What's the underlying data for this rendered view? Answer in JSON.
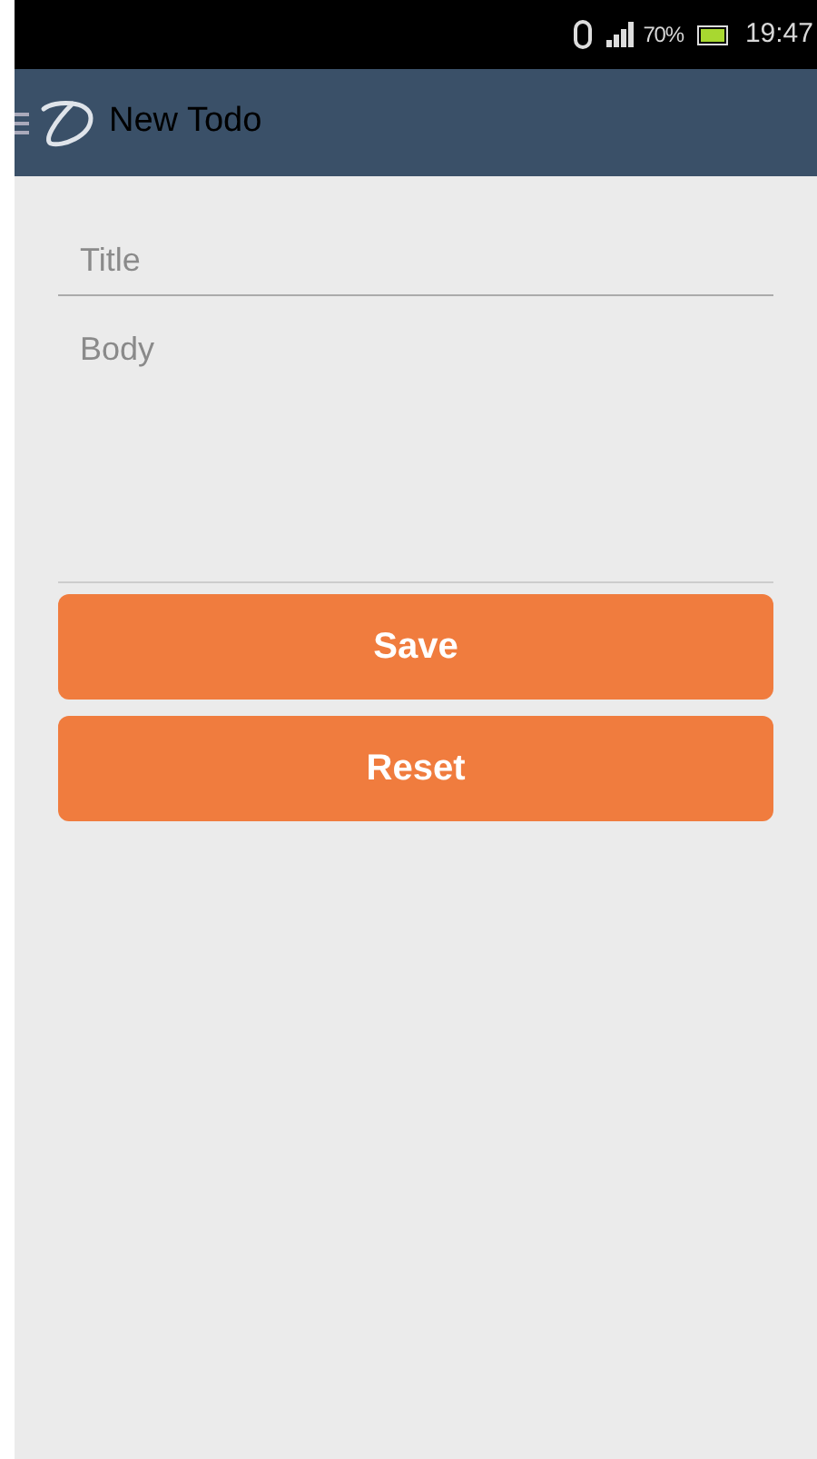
{
  "status_bar": {
    "battery": "70%",
    "time": "19:47"
  },
  "app_bar": {
    "title": "New Todo"
  },
  "form": {
    "title_placeholder": "Title",
    "body_placeholder": "Body"
  },
  "buttons": [
    {
      "label": "Save"
    },
    {
      "label": "Reset"
    }
  ]
}
